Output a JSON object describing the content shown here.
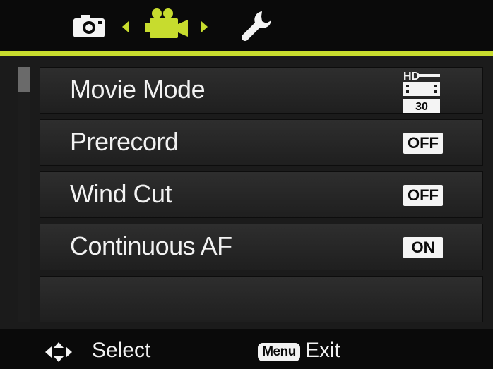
{
  "header": {
    "tabs": [
      {
        "id": "camera",
        "icon": "camera-icon",
        "active": false
      },
      {
        "id": "movie",
        "icon": "movie-camera-icon",
        "active": true
      },
      {
        "id": "setup",
        "icon": "wrench-icon",
        "active": false
      }
    ]
  },
  "colors": {
    "accent": "#c7dc2e",
    "background": "#111111",
    "row": "#2a2a2a",
    "text": "#f2f2f2"
  },
  "menu": {
    "items": [
      {
        "label": "Movie Mode",
        "value_icon": "hd-movie-icon",
        "value_text": "30",
        "value_badge": "HD"
      },
      {
        "label": "Prerecord",
        "value": "OFF"
      },
      {
        "label": "Wind Cut",
        "value": "OFF"
      },
      {
        "label": "Continuous AF",
        "value": "ON"
      },
      {
        "label": "",
        "value": ""
      }
    ]
  },
  "footer": {
    "select_label": "Select",
    "menu_key": "Menu",
    "exit_label": "Exit"
  }
}
